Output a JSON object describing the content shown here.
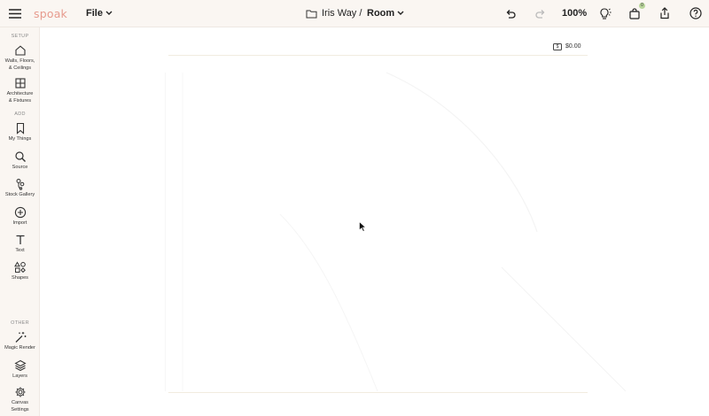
{
  "header": {
    "logo": "spoak",
    "file_menu": "File",
    "breadcrumb": {
      "project": "Iris Way /",
      "room": "Room"
    },
    "zoom": "100%",
    "cart_count": "0"
  },
  "sidebar": {
    "sections": {
      "setup": "SETUP",
      "add": "ADD",
      "other": "OTHER"
    },
    "items": [
      {
        "label": "Walls, Floors,\n& Ceilings",
        "icon": "house-icon"
      },
      {
        "label": "Architecture\n& Fixtures",
        "icon": "grid-icon"
      },
      {
        "label": "My Things",
        "icon": "bookmark-icon"
      },
      {
        "label": "Source",
        "icon": "search-icon"
      },
      {
        "label": "Stock Gallery",
        "icon": "stock-gallery-icon"
      },
      {
        "label": "Import",
        "icon": "plus-circle-icon"
      },
      {
        "label": "Text",
        "icon": "text-icon"
      },
      {
        "label": "Shapes",
        "icon": "shapes-icon"
      },
      {
        "label": "Magic Render",
        "icon": "magic-wand-icon"
      },
      {
        "label": "Layers",
        "icon": "layers-icon"
      },
      {
        "label": "Canvas\nSettings",
        "icon": "gear-icon"
      }
    ]
  },
  "canvas": {
    "price": "$0.00"
  },
  "colors": {
    "chrome_bg": "#faf6f2",
    "logo": "#e79b8e",
    "badge": "#b9d69b"
  }
}
